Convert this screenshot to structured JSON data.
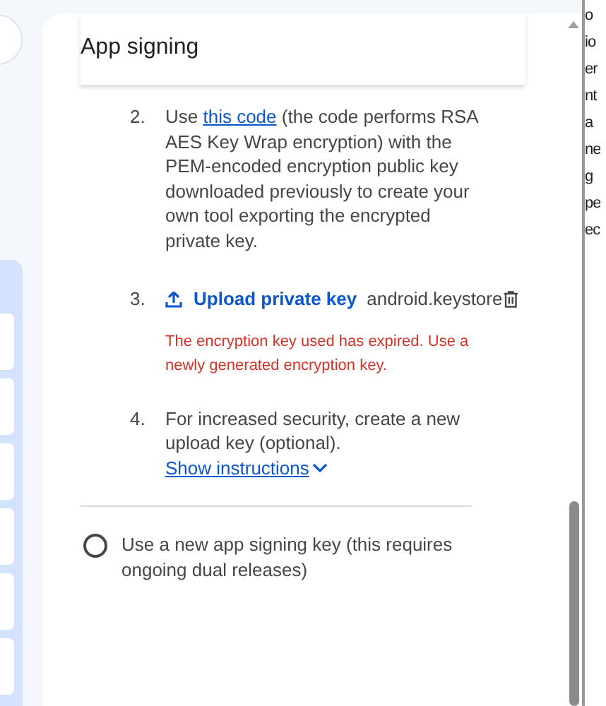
{
  "dialog": {
    "title": "App signing",
    "steps": [
      {
        "kind": "text",
        "number": "2.",
        "link": "this code",
        "before": "Use ",
        "after": " (the code performs RSA AES Key Wrap encryption) with the PEM-encoded encryption public key downloaded previously to create your own tool exporting the encrypted private key."
      },
      {
        "kind": "upload",
        "number": "3.",
        "button": "Upload private key",
        "file": "android.keystore",
        "error": "The encryption key used has expired. Use a newly generated encryption key."
      },
      {
        "kind": "instructions",
        "number": "4.",
        "text": "For increased security, create a new upload key (optional).",
        "link": "Show instructions",
        "expanded": false
      }
    ],
    "option": {
      "label": "Use a new app signing key (this requires ongoing dual releases)",
      "selected": false
    }
  },
  "background_fragments": [
    "o",
    "io",
    "er",
    "nt",
    "a",
    "ne",
    "g",
    "pe",
    "ec"
  ]
}
